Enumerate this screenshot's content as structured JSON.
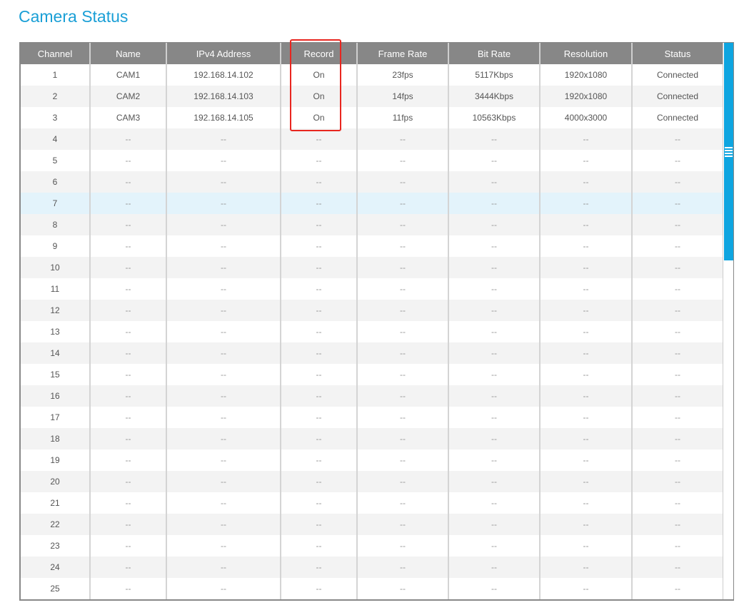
{
  "page": {
    "title": "Camera Status"
  },
  "table": {
    "headers": [
      "Channel",
      "Name",
      "IPv4 Address",
      "Record",
      "Frame Rate",
      "Bit Rate",
      "Resolution",
      "Status"
    ],
    "rows": [
      [
        "1",
        "CAM1",
        "192.168.14.102",
        "On",
        "23fps",
        "5117Kbps",
        "1920x1080",
        "Connected"
      ],
      [
        "2",
        "CAM2",
        "192.168.14.103",
        "On",
        "14fps",
        "3444Kbps",
        "1920x1080",
        "Connected"
      ],
      [
        "3",
        "CAM3",
        "192.168.14.105",
        "On",
        "11fps",
        "10563Kbps",
        "4000x3000",
        "Connected"
      ],
      [
        "4",
        "--",
        "--",
        "--",
        "--",
        "--",
        "--",
        "--"
      ],
      [
        "5",
        "--",
        "--",
        "--",
        "--",
        "--",
        "--",
        "--"
      ],
      [
        "6",
        "--",
        "--",
        "--",
        "--",
        "--",
        "--",
        "--"
      ],
      [
        "7",
        "--",
        "--",
        "--",
        "--",
        "--",
        "--",
        "--"
      ],
      [
        "8",
        "--",
        "--",
        "--",
        "--",
        "--",
        "--",
        "--"
      ],
      [
        "9",
        "--",
        "--",
        "--",
        "--",
        "--",
        "--",
        "--"
      ],
      [
        "10",
        "--",
        "--",
        "--",
        "--",
        "--",
        "--",
        "--"
      ],
      [
        "11",
        "--",
        "--",
        "--",
        "--",
        "--",
        "--",
        "--"
      ],
      [
        "12",
        "--",
        "--",
        "--",
        "--",
        "--",
        "--",
        "--"
      ],
      [
        "13",
        "--",
        "--",
        "--",
        "--",
        "--",
        "--",
        "--"
      ],
      [
        "14",
        "--",
        "--",
        "--",
        "--",
        "--",
        "--",
        "--"
      ],
      [
        "15",
        "--",
        "--",
        "--",
        "--",
        "--",
        "--",
        "--"
      ],
      [
        "16",
        "--",
        "--",
        "--",
        "--",
        "--",
        "--",
        "--"
      ],
      [
        "17",
        "--",
        "--",
        "--",
        "--",
        "--",
        "--",
        "--"
      ],
      [
        "18",
        "--",
        "--",
        "--",
        "--",
        "--",
        "--",
        "--"
      ],
      [
        "19",
        "--",
        "--",
        "--",
        "--",
        "--",
        "--",
        "--"
      ],
      [
        "20",
        "--",
        "--",
        "--",
        "--",
        "--",
        "--",
        "--"
      ],
      [
        "21",
        "--",
        "--",
        "--",
        "--",
        "--",
        "--",
        "--"
      ],
      [
        "22",
        "--",
        "--",
        "--",
        "--",
        "--",
        "--",
        "--"
      ],
      [
        "23",
        "--",
        "--",
        "--",
        "--",
        "--",
        "--",
        "--"
      ],
      [
        "24",
        "--",
        "--",
        "--",
        "--",
        "--",
        "--",
        "--"
      ],
      [
        "25",
        "--",
        "--",
        "--",
        "--",
        "--",
        "--",
        "--"
      ]
    ],
    "highlighted_row": 7,
    "annotated_column": "Record"
  },
  "colors": {
    "title": "#1a9fd6",
    "header_bg": "#878787",
    "scroll_thumb": "#0ea5e0",
    "annotation": "#e8261f",
    "highlight_row": "#e3f3fb"
  }
}
